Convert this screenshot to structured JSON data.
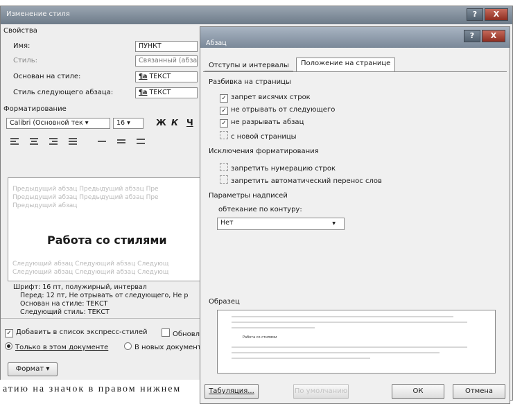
{
  "style_dialog": {
    "title": "Изменение стиля",
    "properties_heading": "Свойства",
    "name_label": "Имя:",
    "name_value": "ПУНКТ",
    "style_label": "Стиль:",
    "style_value": "Связанный (абза",
    "based_on_label": "Основан на стиле:",
    "based_on_value": "ТЕКСТ",
    "next_style_label": "Стиль следующего абзаца:",
    "next_style_value": "ТЕКСТ",
    "formatting_heading": "Форматирование",
    "font_value": "Calibri (Основной тек",
    "size_value": "16",
    "bold_label": "Ж",
    "italic_label": "К",
    "underline_label": "Ч",
    "preview_prev_lines": [
      "Предыдущий абзац Предыдущий абзац Пре",
      "Предыдущий абзац Предыдущий абзац Пре",
      "Предыдущий абзац"
    ],
    "preview_heading": "Работа со стилями",
    "preview_next_lines": [
      "Следующий абзац Следующий абзац Следующ",
      "Следующий абзац Следующий абзац Следующ"
    ],
    "description_lines": [
      "Шрифт: 16 пт, полужирный, интервал",
      "Перед:  12 пт, Не отрывать от следующего, Не р",
      "Основан на стиле: ТЕКСТ",
      "Следующий стиль: ТЕКСТ"
    ],
    "quick_styles_label": "Добавить в список экспресс-стилей",
    "auto_update_label": "Обновл",
    "this_doc_label": "Только в этом документе",
    "new_docs_label": "В новых документ",
    "format_button": "Формат ▾"
  },
  "para_dialog": {
    "title": "Абзац",
    "help_btn": "?",
    "close_btn": "X",
    "tabs": [
      "Отступы и интервалы",
      "Положение на странице"
    ],
    "pagination_heading": "Разбивка на страницы",
    "pagination_items": [
      {
        "label": "запрет висячих строк",
        "checked": true
      },
      {
        "label": "не отрывать от следующего",
        "checked": true
      },
      {
        "label": "не разрывать абзац",
        "checked": true
      },
      {
        "label": "с новой страницы",
        "checked": false
      }
    ],
    "exceptions_heading": "Исключения форматирования",
    "exceptions_items": [
      {
        "label": "запретить нумерацию строк",
        "checked": false
      },
      {
        "label": "запретить автоматический перенос слов",
        "checked": false
      }
    ],
    "textbox_heading": "Параметры надписей",
    "wrap_label": "обтекание по контуру:",
    "wrap_value": "Нет",
    "sample_heading": "Образец",
    "sample_text": "Работа со стилями",
    "tabs_button": "Табуляция...",
    "default_button": "По умолчанию",
    "ok_button": "ОК",
    "cancel_button": "Отмена"
  },
  "outer_title_buttons": {
    "help": "?",
    "close": "X"
  },
  "bottom_text": "атию на значок в правом нижнем"
}
